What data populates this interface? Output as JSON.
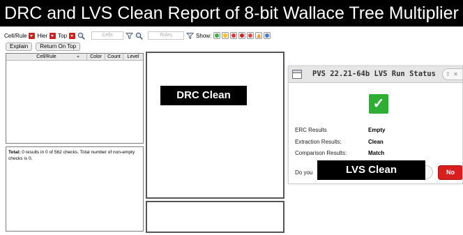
{
  "banner": {
    "title": "DRC and LVS Clean Report of 8-bit Wallace Tree Multiplier"
  },
  "drc": {
    "toolbar": {
      "cell_rule_label": "Cell/Rule",
      "hier_label": "Hier",
      "top_label": "Top",
      "cells_placeholder": "Cells",
      "rules_placeholder": "Rules",
      "show_label": "Show:"
    },
    "buttons": {
      "explain": "Explain",
      "return_on_top": "Return On Top"
    },
    "table": {
      "columns": [
        "Cell/Rule",
        "Color",
        "Count",
        "Level"
      ],
      "rows": []
    },
    "summary": {
      "bold": "Total:",
      "text": " 0 results in 0 of 562 checks. Total number of non-empty checks is 0."
    },
    "overlay_label": "DRC Clean"
  },
  "lvs": {
    "title": "PVS 22.21-64b LVS Run Status",
    "status_icon": "check-icon",
    "results": [
      {
        "label": "ERC Results",
        "value": "Empty"
      },
      {
        "label": "Extraction Results:",
        "value": "Clean"
      },
      {
        "label": "Comparison Results:",
        "value": "Match"
      }
    ],
    "prompt": "Do you",
    "no_button": "No",
    "overlay_label": "LVS Clean",
    "colors": {
      "check": "#2fae35",
      "no_button": "#d81f1f"
    }
  }
}
